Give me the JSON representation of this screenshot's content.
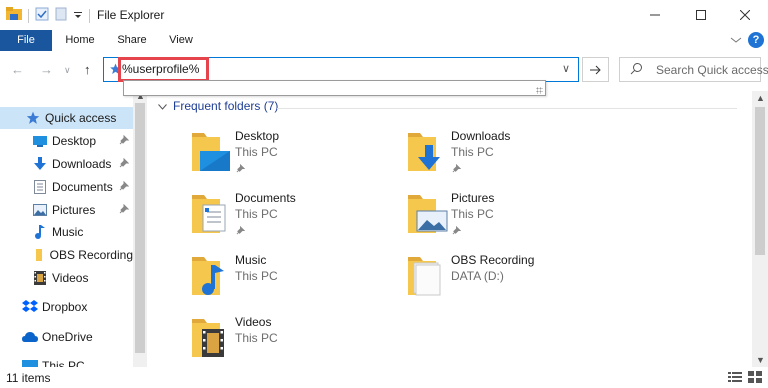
{
  "window": {
    "title": "File Explorer"
  },
  "ribbon": {
    "tabs": [
      "File",
      "Home",
      "Share",
      "View"
    ],
    "help_label": "?"
  },
  "address": {
    "value": "%userprofile%"
  },
  "search": {
    "placeholder": "Search Quick access"
  },
  "nav": {
    "items": [
      {
        "label": "Quick access",
        "icon": "star-icon",
        "pinned": false,
        "selected": true
      },
      {
        "label": "Desktop",
        "icon": "desktop-icon",
        "pinned": true
      },
      {
        "label": "Downloads",
        "icon": "download-icon",
        "pinned": true
      },
      {
        "label": "Documents",
        "icon": "documents-icon",
        "pinned": true
      },
      {
        "label": "Pictures",
        "icon": "pictures-icon",
        "pinned": true
      },
      {
        "label": "Music",
        "icon": "music-icon",
        "pinned": false
      },
      {
        "label": "OBS Recording",
        "icon": "folder-icon",
        "pinned": false
      },
      {
        "label": "Videos",
        "icon": "videos-icon",
        "pinned": false
      },
      {
        "label": "Dropbox",
        "icon": "dropbox-icon",
        "pinned": false
      },
      {
        "label": "OneDrive",
        "icon": "onedrive-icon",
        "pinned": false
      },
      {
        "label": "This PC",
        "icon": "pc-icon",
        "pinned": false
      }
    ]
  },
  "content": {
    "group_title": "Frequent folders (7)",
    "folders": [
      {
        "name": "Desktop",
        "location": "This PC",
        "pinned": true
      },
      {
        "name": "Downloads",
        "location": "This PC",
        "pinned": true
      },
      {
        "name": "Documents",
        "location": "This PC",
        "pinned": true
      },
      {
        "name": "Pictures",
        "location": "This PC",
        "pinned": true
      },
      {
        "name": "Music",
        "location": "This PC",
        "pinned": false
      },
      {
        "name": "OBS Recording",
        "location": "DATA (D:)",
        "pinned": false
      },
      {
        "name": "Videos",
        "location": "This PC",
        "pinned": false
      }
    ]
  },
  "status": {
    "item_count": "11 items"
  },
  "colors": {
    "accent": "#0078d7",
    "file_tab": "#19569e",
    "highlight": "#e5444d",
    "selected": "#cce4f7",
    "folder": "#f5c74d",
    "group_header": "#1e3e94"
  }
}
